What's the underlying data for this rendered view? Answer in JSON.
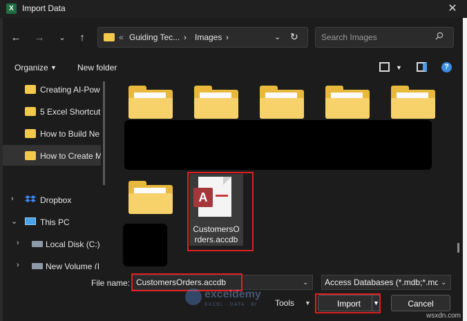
{
  "window": {
    "title": "Import Data",
    "app_icon_letter": "X",
    "close": "✕"
  },
  "address": {
    "crumb_prefix": "«",
    "crumbs": [
      "Guiding Tec...",
      "Images"
    ],
    "separator": "›",
    "search_placeholder": "Search Images"
  },
  "toolbar": {
    "organize": "Organize",
    "new_folder": "New folder"
  },
  "sidebar": {
    "items": [
      {
        "label": "Creating AI-Pow",
        "icon": "folder-icon"
      },
      {
        "label": "5 Excel Shortcut",
        "icon": "folder-icon"
      },
      {
        "label": "How to Build Ne",
        "icon": "folder-icon"
      },
      {
        "label": "How to Create M",
        "icon": "folder-icon",
        "selected": true
      },
      {
        "label": "Dropbox",
        "icon": "dropbox-icon"
      },
      {
        "label": "This PC",
        "icon": "pc-icon"
      },
      {
        "label": "Local Disk (C:)",
        "icon": "disk-icon"
      },
      {
        "label": "New Volume (I",
        "icon": "disk-icon"
      }
    ]
  },
  "files": {
    "selected_file_line1": "CustomersO",
    "selected_file_line2": "rders.accdb",
    "access_letter": "A"
  },
  "bottom": {
    "file_name_label": "File name:",
    "file_name_value": "CustomersOrders.accdb",
    "file_type": "Access Databases (*.mdb;*.mde",
    "tools": "Tools",
    "import": "Import",
    "cancel": "Cancel"
  },
  "watermark": {
    "title": "exceldemy",
    "subtitle": "EXCEL · DATA · BI"
  },
  "corner_mark": "wsxdn.com",
  "colors": {
    "highlight": "#e02020",
    "folder": "#f2c94c",
    "access": "#a4373a",
    "background": "#1c1c1c"
  }
}
